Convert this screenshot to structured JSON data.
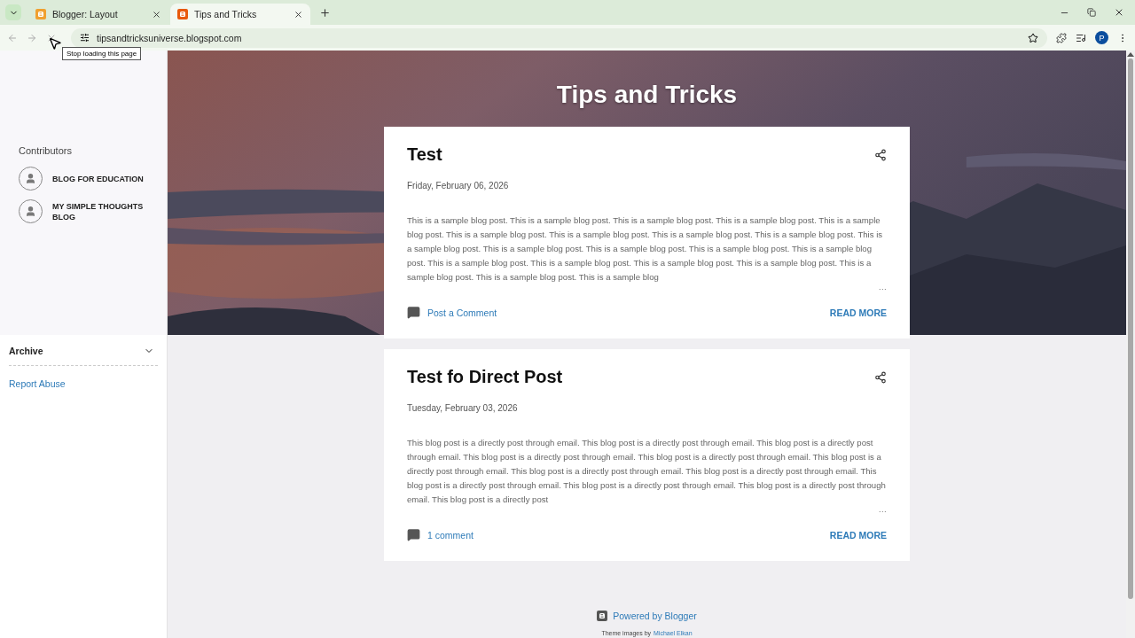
{
  "browser": {
    "tabs": [
      {
        "title": "Blogger: Layout",
        "selected": false
      },
      {
        "title": "Tips and Tricks",
        "selected": true
      }
    ],
    "address": "tipsandtricksuniverse.blogspot.com",
    "profile_initial": "P",
    "tooltip": "Stop loading this page"
  },
  "sidebar": {
    "heading": "Contributors",
    "contributors": [
      "BLOG FOR EDUCATION",
      "MY SIMPLE THOUGHTS BLOG"
    ],
    "archive": {
      "label": "Archive",
      "expanded": false
    },
    "report_link": "Report Abuse"
  },
  "blog_title": "Tips and Tricks",
  "posts": [
    {
      "title": "Test",
      "date": "Friday, February 06, 2026",
      "body": "This is a sample blog post. This is a sample blog post. This is a sample blog post. This is a sample blog post. This is a sample blog post. This is a sample blog post. This is a sample blog post. This is a sample blog post. This is a sample blog post. This is a sample blog post. This is a sample blog post. This is a sample blog post. This is a sample blog post. This is a sample blog post. This is a sample blog post. This is a sample blog post. This is a sample blog post. This is a sample blog post. This is a sample blog post. This is a sample blog post. This is a sample blog",
      "ellipsis": "…",
      "comments": "Post a Comment",
      "read_more": "READ MORE"
    },
    {
      "title": "Test fo Direct Post",
      "date": "Tuesday, February 03, 2026",
      "body": "This blog post is a directly post through email. This blog post is a directly post through email. This blog post is a directly post through email. This blog post is a directly post through email. This blog post is a directly post through email. This blog post is a directly post through email. This blog post is a directly post through email. This blog post is a directly post through email. This blog post is a directly post through email. This blog post is a directly post through email. This blog post is a directly post through email. This blog post is a directly post",
      "ellipsis": "…",
      "comments": "1 comment",
      "read_more": "READ MORE"
    }
  ],
  "footer": {
    "powered": "Powered by Blogger",
    "credit_prefix": "Theme images by",
    "credit_author": "Michael Elkan"
  }
}
